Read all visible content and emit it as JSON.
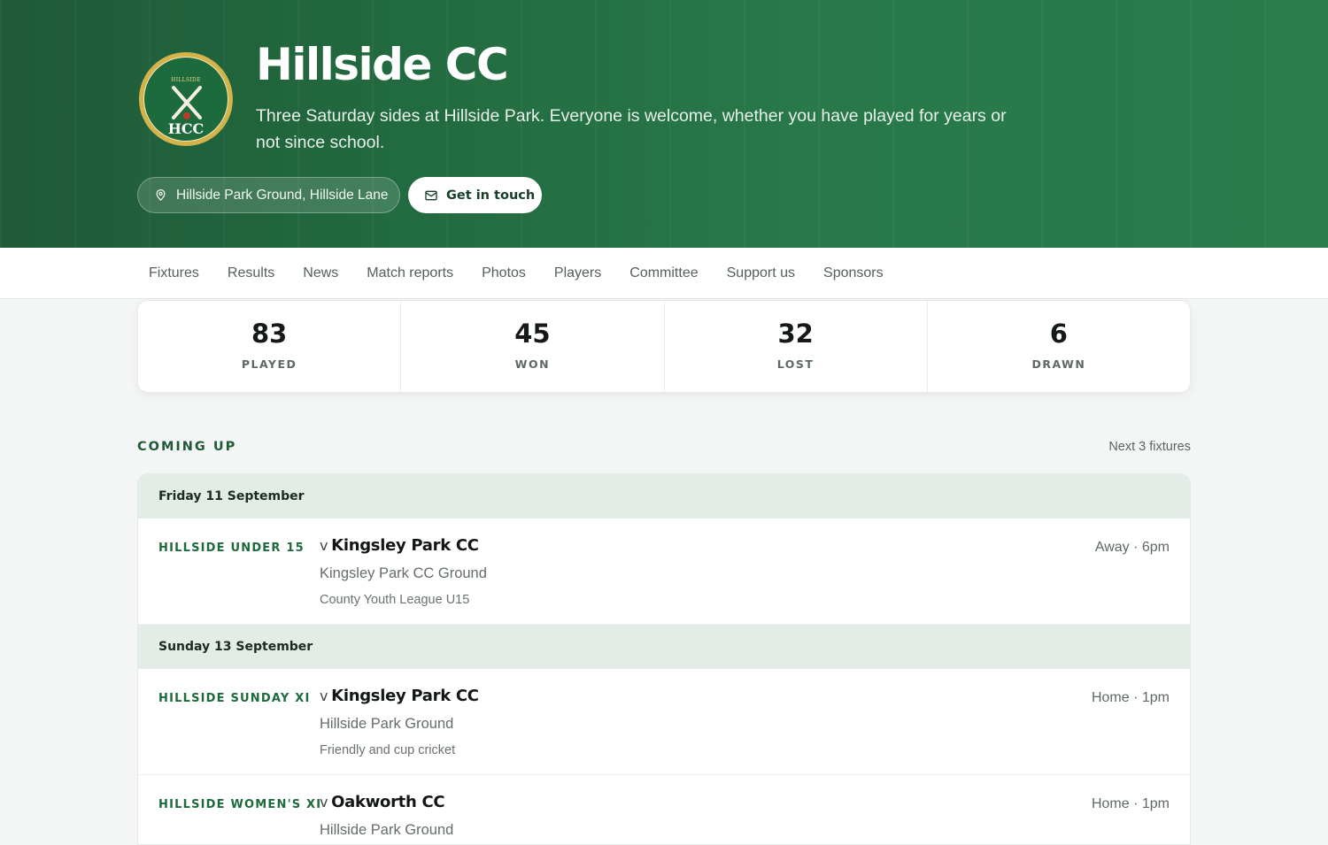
{
  "header": {
    "badge_top": "HILLSIDE",
    "badge_bottom": "HCC",
    "title": "Hillside CC",
    "tagline": "Three Saturday sides at Hillside Park. Everyone is welcome, whether you have played for years or not since school.",
    "location": "Hillside Park Ground, Hillside Lane",
    "location_icon": "map-pin-icon",
    "contact_label": "Get in touch",
    "contact_icon": "envelope-icon"
  },
  "nav": {
    "items": [
      "Fixtures",
      "Results",
      "News",
      "Match reports",
      "Photos",
      "Players",
      "Committee",
      "Support us",
      "Sponsors"
    ]
  },
  "stats": [
    {
      "value": "83",
      "label": "PLAYED"
    },
    {
      "value": "45",
      "label": "WON"
    },
    {
      "value": "32",
      "label": "LOST"
    },
    {
      "value": "6",
      "label": "DRAWN"
    }
  ],
  "coming_up": {
    "title": "COMING UP",
    "subtitle": "Next 3 fixtures",
    "days": [
      {
        "date": "Friday 11 September",
        "fixtures": [
          {
            "team": "HILLSIDE UNDER 15",
            "v": "v",
            "opponent": "Kingsley Park CC",
            "ground": "Kingsley Park CC Ground",
            "competition": "County Youth League U15",
            "time": "Away · 6pm"
          }
        ]
      },
      {
        "date": "Sunday 13 September",
        "fixtures": [
          {
            "team": "HILLSIDE SUNDAY XI",
            "v": "v",
            "opponent": "Kingsley Park CC",
            "ground": "Hillside Park Ground",
            "competition": "Friendly and cup cricket",
            "time": "Home · 1pm"
          },
          {
            "team": "HILLSIDE WOMEN'S XI",
            "v": "v",
            "opponent": "Oakworth CC",
            "ground": "Hillside Park Ground",
            "competition": "",
            "time": "Home · 1pm"
          }
        ]
      }
    ]
  },
  "colors": {
    "brand_green": "#226a3f",
    "badge_gold": "#d4b44a",
    "day_header_bg": "#e3ece6",
    "team_label": "#1d6a3a"
  }
}
